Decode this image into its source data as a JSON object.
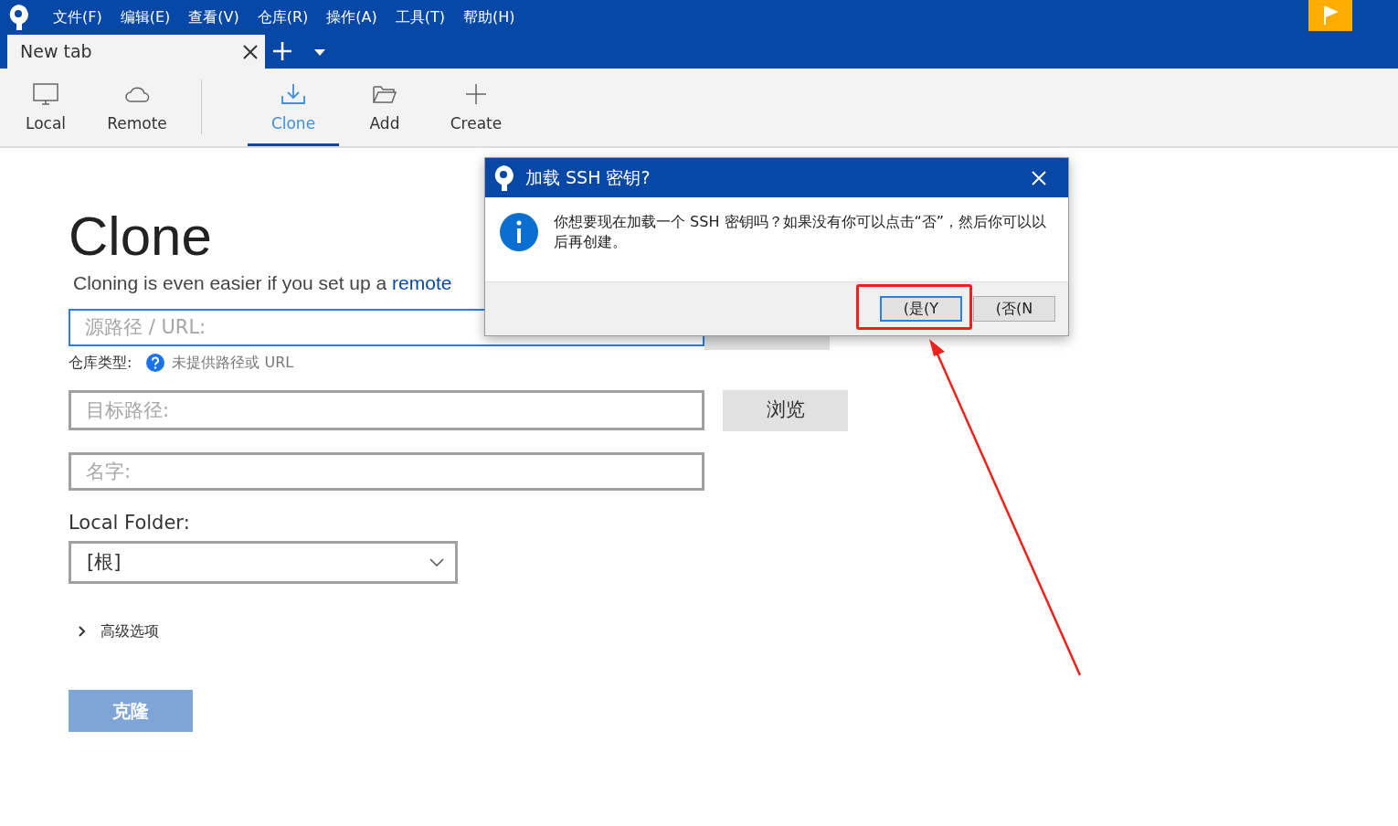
{
  "menu": [
    "文件(F)",
    "编辑(E)",
    "查看(V)",
    "仓库(R)",
    "操作(A)",
    "工具(T)",
    "帮助(H)"
  ],
  "tabs": [
    {
      "label": "New tab",
      "selected": true
    }
  ],
  "toolbar": {
    "groups": [
      [
        {
          "label": "Local",
          "kind": "monitor",
          "selected": false
        },
        {
          "label": "Remote",
          "kind": "cloud",
          "selected": false
        }
      ],
      [
        {
          "label": "Clone",
          "kind": "download",
          "selected": true
        },
        {
          "label": "Add",
          "kind": "folder",
          "selected": false
        },
        {
          "label": "Create",
          "kind": "plus",
          "selected": false
        }
      ]
    ]
  },
  "clone": {
    "title": "Clone",
    "subtitle": "Cloning is even easier if you set up a ",
    "subtitle_link": "remote",
    "source_field": {
      "placeholder": "源路径 / URL:",
      "focused": true
    },
    "repo_type_label": "仓库类型:",
    "repo_type_value": "未提供路径或 URL",
    "dest_field": {
      "placeholder": "目标路径:",
      "focused": false
    },
    "browse_button": "浏览",
    "name_field": {
      "placeholder": "名字:",
      "focused": false
    },
    "local_folder_label": "Local Folder:",
    "local_folder_value": "[根]",
    "advanced": {
      "label": "高级选项",
      "expanded": false
    },
    "clone_button": {
      "label": "克隆",
      "disabled": true
    }
  },
  "dialog": {
    "title": "加载 SSH 密钥?",
    "message": "你想要现在加载一个 SSH 密钥吗？如果没有你可以点击“否”，然后你可以以后再创建。",
    "buttons": [
      {
        "label": "(是(Y",
        "selected": true
      },
      {
        "label": "(否(N",
        "selected": false
      }
    ]
  }
}
